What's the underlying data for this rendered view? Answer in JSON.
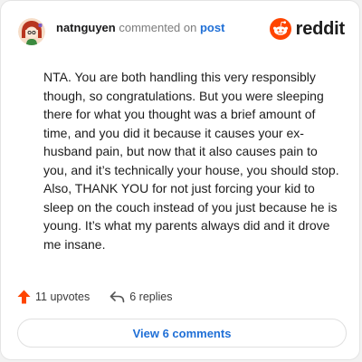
{
  "header": {
    "username": "natnguyen",
    "action_text": "commented on",
    "post_link": "post",
    "brand": "reddit"
  },
  "comment": {
    "text": "NTA. You are both handling this very responsibly though, so congratulations. But you were sleeping there for what you thought was a brief amount of time, and you did it because it causes your ex-husband pain, but now that it also causes pain to you, and it’s technically your house, you should stop. Also, THANK YOU for not just forcing your kid to sleep on the couch instead of you just because he is young. It’s what my parents always did and it drove me insane."
  },
  "stats": {
    "upvotes_label": "11 upvotes",
    "replies_label": "6 replies"
  },
  "footer": {
    "view_label": "View 6 comments"
  },
  "colors": {
    "brand_orange": "#ff4500",
    "link_blue": "#1f6fd6",
    "text": "#1c1c1c",
    "muted": "#7c7c7c"
  },
  "icons": [
    "avatar-icon",
    "reddit-logo-icon",
    "upvote-arrow-icon",
    "reply-arrow-icon"
  ]
}
